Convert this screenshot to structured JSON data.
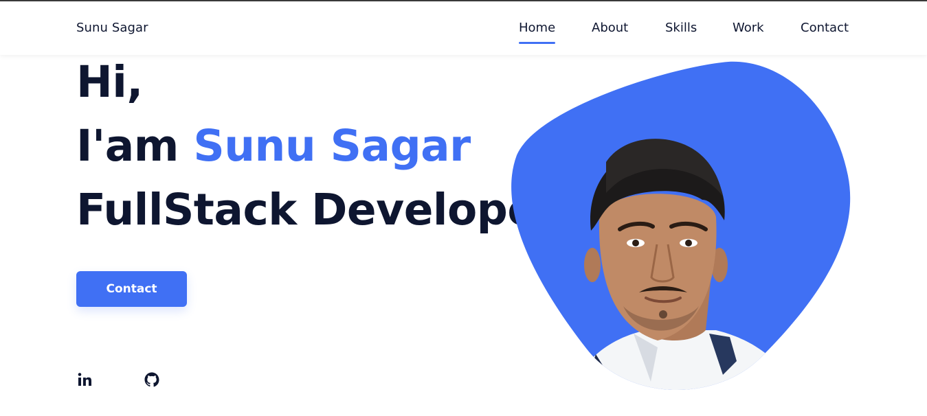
{
  "header": {
    "brand": "Sunu Sagar",
    "nav": [
      {
        "label": "Home",
        "active": true
      },
      {
        "label": "About",
        "active": false
      },
      {
        "label": "Skills",
        "active": false
      },
      {
        "label": "Work",
        "active": false
      },
      {
        "label": "Contact",
        "active": false
      }
    ]
  },
  "hero": {
    "line1": "Hi,",
    "line2_prefix": "I'am ",
    "line2_name": "Sunu Sagar",
    "line3": "FullStack Developer",
    "button_label": "Contact"
  },
  "social": {
    "icons": [
      "linkedin-icon",
      "github-icon"
    ]
  },
  "colors": {
    "accent": "#4070f4",
    "text": "#0e1630",
    "background": "#ffffff"
  }
}
